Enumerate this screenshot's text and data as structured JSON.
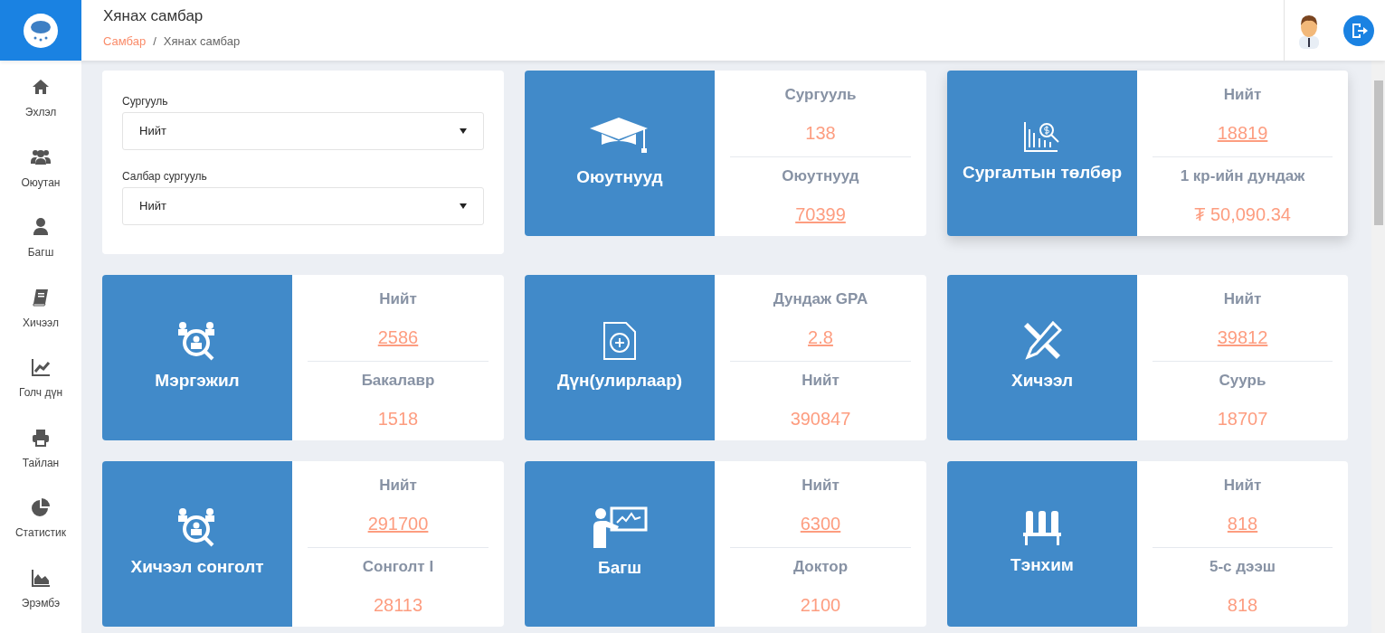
{
  "header": {
    "title": "Хянах самбар",
    "breadcrumb": [
      {
        "label": "Самбар",
        "link": true
      },
      {
        "label": "Хянах самбар",
        "link": false
      }
    ],
    "separator": "/"
  },
  "sidebar": {
    "items": [
      {
        "label": "Эхлэл"
      },
      {
        "label": "Оюутан"
      },
      {
        "label": "Багш"
      },
      {
        "label": "Хичээл"
      },
      {
        "label": "Голч дүн"
      },
      {
        "label": "Тайлан"
      },
      {
        "label": "Статистик"
      },
      {
        "label": "Эрэмбэ"
      }
    ]
  },
  "filters": [
    {
      "label": "Сургууль",
      "value": "Нийт"
    },
    {
      "label": "Салбар сургууль",
      "value": "Нийт"
    }
  ],
  "cards": [
    {
      "title": "Оюутнууд",
      "stats": [
        {
          "label": "Сургууль",
          "value": "138",
          "link": false
        },
        {
          "label": "Оюутнууд",
          "value": "70399",
          "link": true
        }
      ]
    },
    {
      "title": "Сургалтын төлбөр",
      "stats": [
        {
          "label": "Нийт",
          "value": "18819",
          "link": true
        },
        {
          "label": "1 кр-ийн дундаж",
          "value": "₮ 50,090.34",
          "link": false
        }
      ]
    },
    {
      "title": "Мэргэжил",
      "stats": [
        {
          "label": "Нийт",
          "value": "2586",
          "link": true
        },
        {
          "label": "Бакалавр",
          "value": "1518",
          "link": false
        }
      ]
    },
    {
      "title": "Дүн(улирлаар)",
      "stats": [
        {
          "label": "Дундаж GPA",
          "value": "2.8",
          "link": true
        },
        {
          "label": "Нийт",
          "value": "390847",
          "link": false
        }
      ]
    },
    {
      "title": "Хичээл",
      "stats": [
        {
          "label": "Нийт",
          "value": "39812",
          "link": true
        },
        {
          "label": "Суурь",
          "value": "18707",
          "link": false
        }
      ]
    },
    {
      "title": "Хичээл сонголт",
      "stats": [
        {
          "label": "Нийт",
          "value": "291700",
          "link": true
        },
        {
          "label": "Сонголт I",
          "value": "28113",
          "link": false
        }
      ]
    },
    {
      "title": "Багш",
      "stats": [
        {
          "label": "Нийт",
          "value": "6300",
          "link": true
        },
        {
          "label": "Доктор",
          "value": "2100",
          "link": false
        }
      ]
    },
    {
      "title": "Тэнхим",
      "stats": [
        {
          "label": "Нийт",
          "value": "818",
          "link": true
        },
        {
          "label": "5-с дээш",
          "value": "818",
          "link": false
        }
      ]
    }
  ]
}
